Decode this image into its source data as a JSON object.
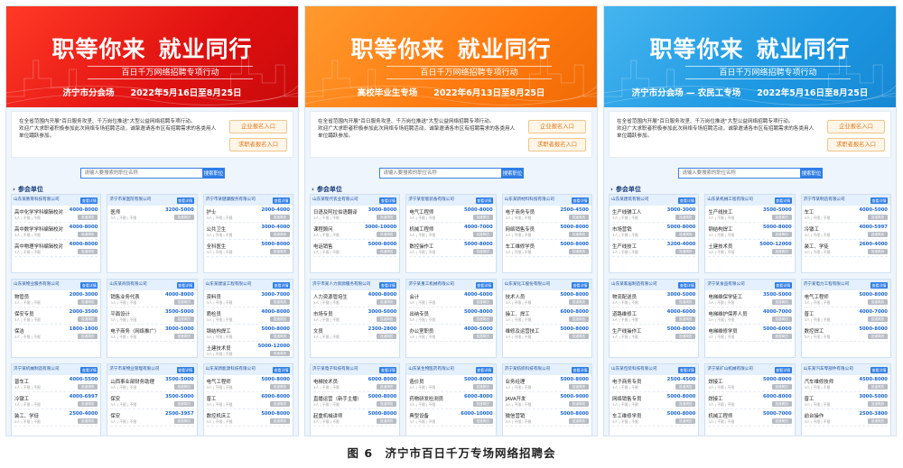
{
  "common": {
    "title_a": "职等你来",
    "title_b": "就业同行",
    "subtitle": "百日千万网络招聘专项行动",
    "intro_1": "在全省范围内开展\"百日服务攻坚、千万岗位推送\"大型公益网络招聘专项行动。",
    "intro_2": "欢迎广大求职者积极参加此次网络专场招聘活动，诚挚邀请各市区有招聘需求的各类用人单位踊跃参加。",
    "btn_company": "企业报名入口",
    "btn_seeker": "求职者报名入口",
    "search_placeholder": "请输入要搜索的职位名称",
    "search_button": "搜索职位",
    "section_title": "参会单位",
    "view_button": "查看详情",
    "apply_button": "投递简历",
    "job_meta": "3人 | 不限 | 不限"
  },
  "panels": [
    {
      "theme": "red",
      "session": "济宁市分会场",
      "date": "2022年5月16日至8月25日",
      "companies": [
        {
          "name": "山东某教育科技有限公司",
          "jobs": [
            [
              "高中化学学科编辑校对",
              "4000-8000"
            ],
            [
              "高中数学学科编辑校对",
              "4000-8000"
            ],
            [
              "高中物理学科编辑校对",
              "4000-8000"
            ]
          ]
        },
        {
          "name": "济宁市某医院有限公司",
          "jobs": [
            [
              "医师",
              "3200-5000"
            ]
          ]
        },
        {
          "name": "济宁市某健康服务有限公司",
          "jobs": [
            [
              "护士",
              "2000-4000"
            ],
            [
              "公共卫生",
              "3000-4000"
            ],
            [
              "全科医生",
              "5000-8000"
            ]
          ]
        },
        {
          "name": "山东某物业服务有限公司",
          "jobs": [
            [
              "物管员",
              "2000-3000"
            ],
            [
              "保安专员",
              "2000-3500"
            ],
            [
              "保洁",
              "1800-1800"
            ]
          ]
        },
        {
          "name": "山东某商贸有限公司",
          "jobs": [
            [
              "销售业务代表",
              "4000-8000"
            ],
            [
              "平面设计",
              "3500-5000"
            ],
            [
              "电子商务（网络推广）",
              "3000-5000"
            ]
          ]
        },
        {
          "name": "山东某建设工程有限公司",
          "jobs": [
            [
              "资料员",
              "3000-7000"
            ],
            [
              "质检员",
              "4000-8000"
            ],
            [
              "钢结构焊工",
              "5000-8000"
            ],
            [
              "土建技术员",
              "5000-12000"
            ]
          ]
        },
        {
          "name": "济宁某机械制造有限公司",
          "jobs": [
            [
              "普车工",
              "4000-5500"
            ],
            [
              "冷镦工",
              "4000-6997"
            ],
            [
              "装工、学徒",
              "2500-4000"
            ]
          ]
        },
        {
          "name": "济宁市某物业管理有限公司",
          "jobs": [
            [
              "山西事业部财务助理",
              "3500-5000"
            ],
            [
              "保安",
              "3500-5000"
            ],
            [
              "保安",
              "2500-3957"
            ]
          ]
        },
        {
          "name": "山东某新能源科技有限公司",
          "jobs": [
            [
              "电气工程师",
              "5000-8000"
            ],
            [
              "普工",
              "6000-8000"
            ],
            [
              "数控机床工",
              "5000-8000"
            ]
          ]
        }
      ]
    },
    {
      "theme": "orange",
      "session": "高校毕业生专场",
      "date": "2022年6月13日至8月25日",
      "companies": [
        {
          "name": "山东某现代农业有限公司",
          "jobs": [
            [
              "日语及阿拉伯语翻译",
              "3000-8000"
            ],
            [
              "课程顾问",
              "3000-10000"
            ],
            [
              "电话销售",
              "5000-8000"
            ]
          ]
        },
        {
          "name": "济宁某智能装备有限公司",
          "jobs": [
            [
              "电气工程师",
              "5000-8000"
            ],
            [
              "机械工程师",
              "4000-7000"
            ],
            [
              "数控操作工",
              "5000-8000"
            ]
          ]
        },
        {
          "name": "山东某新材料科技有限公司",
          "jobs": [
            [
              "电子商务专员",
              "2500-4500"
            ],
            [
              "网络销售专员",
              "5000-8000"
            ],
            [
              "车工维修学员",
              "5000-8000"
            ]
          ]
        },
        {
          "name": "济宁市某人力资源服务有限公司",
          "jobs": [
            [
              "人力资源管培生",
              "4000-8000"
            ],
            [
              "市场专员",
              "3000-5000"
            ],
            [
              "文员",
              "2300-2800"
            ]
          ]
        },
        {
          "name": "济宁某重工机械有限公司",
          "jobs": [
            [
              "会计",
              "4000-6000"
            ],
            [
              "出纳专员",
              "5000-8000"
            ],
            [
              "办公室职员",
              "4000-5000"
            ]
          ]
        },
        {
          "name": "山东某化工股份有限公司",
          "jobs": [
            [
              "技术人员",
              "5000-8000"
            ],
            [
              "操工、焊工",
              "6000-8000"
            ],
            [
              "维修及运营技工",
              "5000-8000"
            ]
          ]
        },
        {
          "name": "济宁某电子科技有限公司",
          "jobs": [
            [
              "电梯技术员",
              "6000-8000"
            ],
            [
              "直播运营（新手主播）",
              "5000-8000"
            ],
            [
              "起重机械讲师",
              "5000-8000"
            ]
          ]
        },
        {
          "name": "山东某生物医药有限公司",
          "jobs": [
            [
              "造价员",
              "5000-8000"
            ],
            [
              "药物研发检测员",
              "6000-8000"
            ],
            [
              "典型设备",
              "6000-10000"
            ]
          ]
        },
        {
          "name": "济宁某纺织科技有限公司",
          "jobs": [
            [
              "业务经理",
              "5000-8000"
            ],
            [
              "JAVA开发",
              "5000-9000"
            ],
            [
              "微信营销",
              "5000-8000"
            ]
          ]
        }
      ]
    },
    {
      "theme": "blue",
      "session": "济宁市分会场 — 农民工专场",
      "date": "2022年5月16日至8月25日",
      "companies": [
        {
          "name": "山东某建筑有限公司",
          "jobs": [
            [
              "生产线辅工人",
              "3000-3000"
            ],
            [
              "市场营销",
              "5000-8000"
            ],
            [
              "生产线技工",
              "3200-4000"
            ]
          ]
        },
        {
          "name": "山东某机械工程有限公司",
          "jobs": [
            [
              "生产线技工",
              "3500-5000"
            ],
            [
              "钢结构焊工",
              "5000-8000"
            ],
            [
              "土建技术员",
              "5000-12000"
            ]
          ]
        },
        {
          "name": "济宁市某制造有限公司",
          "jobs": [
            [
              "车工",
              "4000-5000"
            ],
            [
              "冷镦工",
              "4000-5997"
            ],
            [
              "装工、学徒",
              "2600-4000"
            ]
          ]
        },
        {
          "name": "山东某家居制造有限公司",
          "jobs": [
            [
              "物流配送员",
              "3000-5000"
            ],
            [
              "道路维修工",
              "4000-6000"
            ],
            [
              "生产线操作工",
              "5000-8000"
            ]
          ]
        },
        {
          "name": "济宁某食品有限公司",
          "jobs": [
            [
              "电梯维保学徒工",
              "3500-5000"
            ],
            [
              "电梯维护保养人员",
              "4000-7000"
            ],
            [
              "电梯维修学员",
              "5000-6000"
            ]
          ]
        },
        {
          "name": "济宁某电力工程有限公司",
          "jobs": [
            [
              "电气工程师",
              "5000-8000"
            ],
            [
              "普工",
              "4000-7000"
            ],
            [
              "数控焊工",
              "5000-8000"
            ]
          ]
        },
        {
          "name": "山东某包装科技有限公司",
          "jobs": [
            [
              "电子商务专员",
              "2500-4500"
            ],
            [
              "网络销售专员",
              "5000-8000"
            ],
            [
              "车工维修学员",
              "5000-8000"
            ]
          ]
        },
        {
          "name": "济宁某矿山机械有限公司",
          "jobs": [
            [
              "焊接工",
              "5000-8000"
            ],
            [
              "焊接工",
              "6000-8000"
            ],
            [
              "机械工程师",
              "5000-7000"
            ]
          ]
        },
        {
          "name": "山东某汽车零部件有限公司",
          "jobs": [
            [
              "汽车维修技师",
              "4500-8000"
            ],
            [
              "普工",
              "3000-5000"
            ],
            [
              "前台操作",
              "2500-3800"
            ]
          ]
        }
      ]
    }
  ],
  "caption": "图 6　济宁市百日千万专场网络招聘会",
  "colors": {
    "red": "#e01010",
    "orange": "#ff7a10",
    "blue": "#1e98e2",
    "link": "#1a66d6",
    "button": "#2f7de6"
  }
}
